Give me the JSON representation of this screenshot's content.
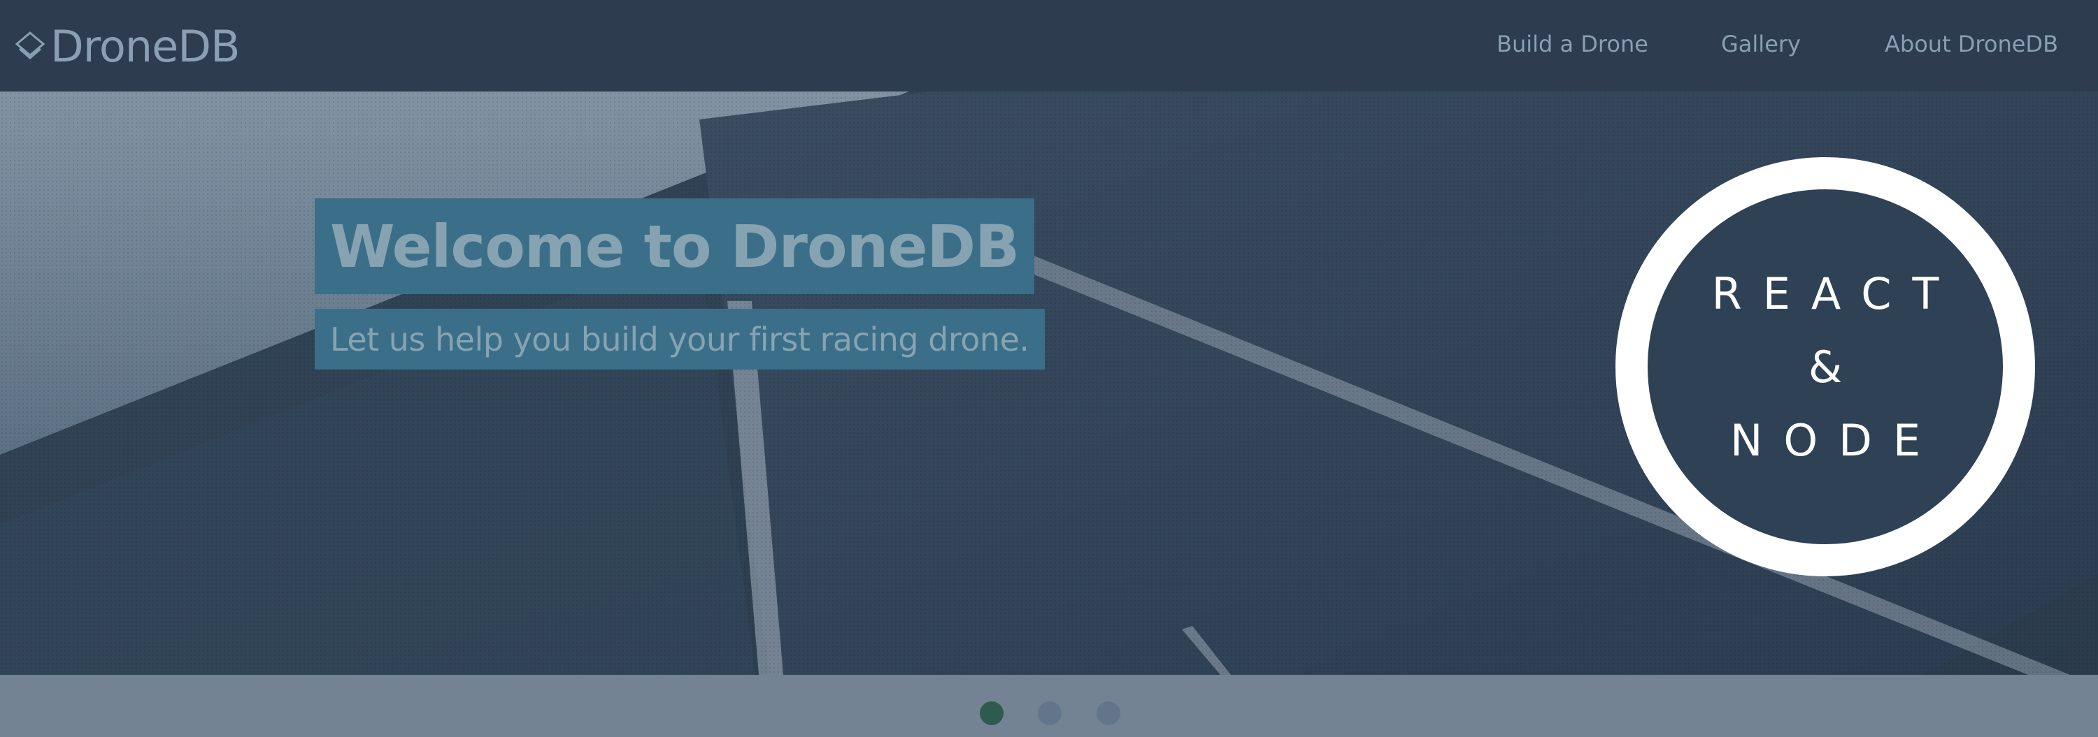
{
  "brand": {
    "name": "DroneDB",
    "color": "#8a9fb3"
  },
  "nav": {
    "items": [
      {
        "label": "Build a Drone"
      },
      {
        "label": "Gallery"
      },
      {
        "label": "About DroneDB"
      }
    ]
  },
  "hero": {
    "title": "Welcome to DroneDB",
    "subtitle": "Let us help you build your first racing drone.",
    "highlight_color": "#3b6f89",
    "badge": {
      "line1": "REACT",
      "line2": "&",
      "line3": "NODE"
    }
  },
  "carousel": {
    "slide_count": 3,
    "active_index": 0,
    "active_color": "#2f5a4e",
    "inactive_color": "#62758a"
  },
  "colors": {
    "navbar": "#2d3c4e",
    "carousel_bar": "#738394"
  }
}
